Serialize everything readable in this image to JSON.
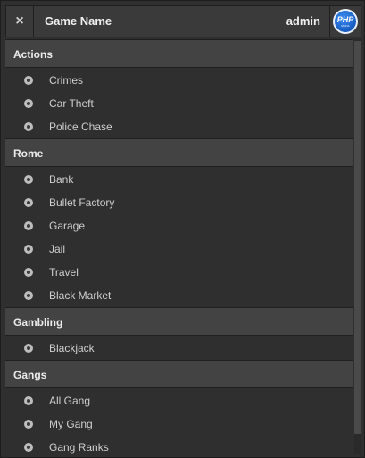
{
  "header": {
    "close_label": "×",
    "game_name": "Game Name",
    "username": "admin",
    "avatar_text": "PHP",
    "avatar_subtext": "MAFIA"
  },
  "sections": [
    {
      "title": "Actions",
      "items": [
        "Crimes",
        "Car Theft",
        "Police Chase"
      ]
    },
    {
      "title": "Rome",
      "items": [
        "Bank",
        "Bullet Factory",
        "Garage",
        "Jail",
        "Travel",
        "Black Market"
      ]
    },
    {
      "title": "Gambling",
      "items": [
        "Blackjack"
      ]
    },
    {
      "title": "Gangs",
      "items": [
        "All Gang",
        "My Gang",
        "Gang Ranks"
      ]
    }
  ],
  "colors": {
    "accent": "#1c63c9",
    "background": "#2f2f2f",
    "header": "#434343"
  }
}
